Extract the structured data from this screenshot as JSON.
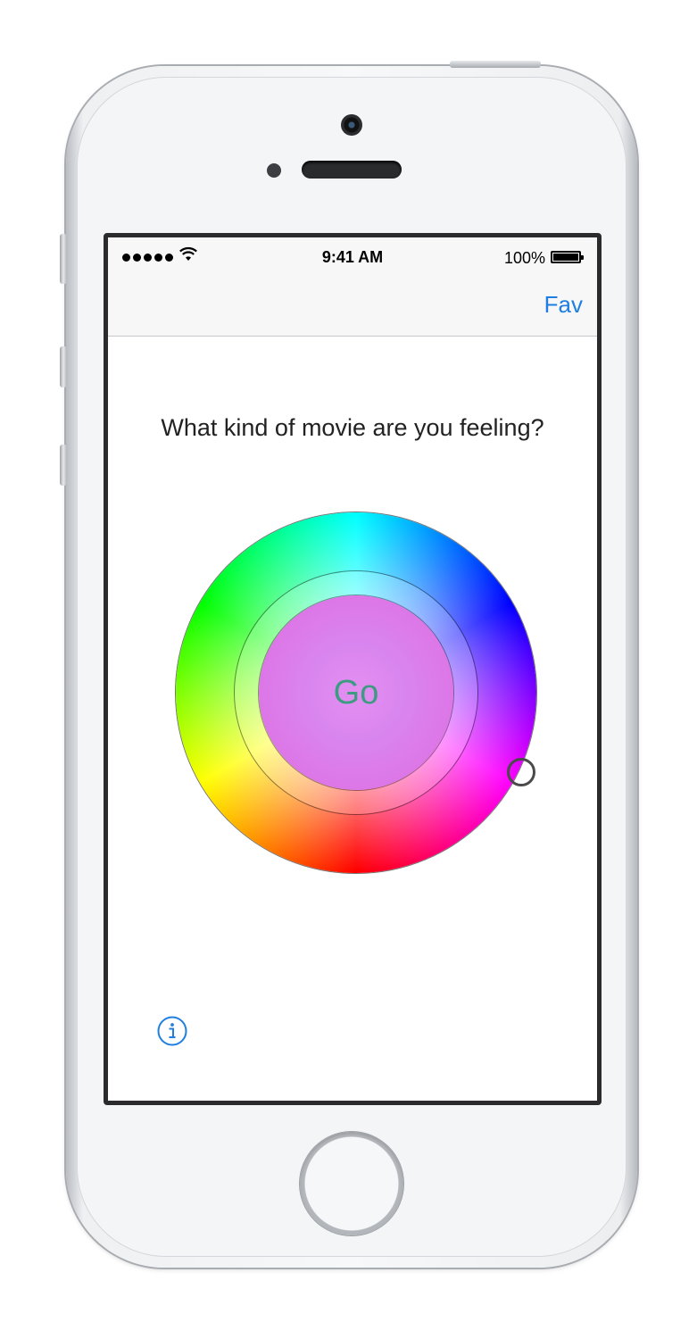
{
  "status_bar": {
    "time": "9:41 AM",
    "battery_percent": "100%",
    "signal_bars": 5,
    "wifi": true,
    "battery_level": 1.0
  },
  "navbar": {
    "fav_label": "Fav"
  },
  "main": {
    "question": "What kind of movie are you feeling?",
    "go_label": "Go"
  },
  "icons": {
    "info": "info-icon"
  },
  "colors": {
    "accent": "#1f7fe0",
    "go_text": "#3c9b80",
    "go_fill": "#e38ff0"
  }
}
